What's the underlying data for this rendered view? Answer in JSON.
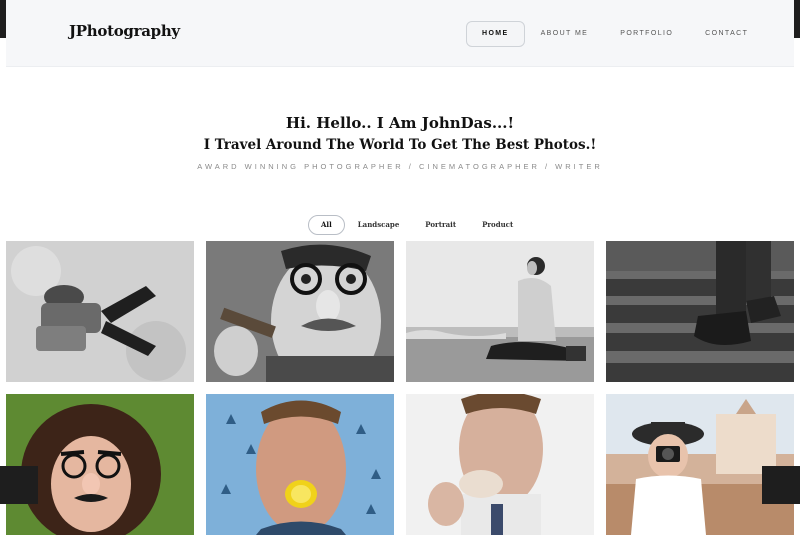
{
  "brand": "JPhotography",
  "nav": [
    {
      "label": "HOME",
      "active": true
    },
    {
      "label": "ABOUT ME",
      "active": false
    },
    {
      "label": "PORTFOLIO",
      "active": false
    },
    {
      "label": "CONTACT",
      "active": false
    }
  ],
  "hero": {
    "greeting": "Hi. Hello.. I Am JohnDas...!",
    "subtitle": "I Travel Around The World To Get The Best Photos.!",
    "tagline": "AWARD WINNING PHOTOGRAPHER / CINEMATOGRAPHER / WRITER"
  },
  "filters": [
    {
      "label": "All",
      "active": true
    },
    {
      "label": "Landscape",
      "active": false
    },
    {
      "label": "Portrait",
      "active": false
    },
    {
      "label": "Product",
      "active": false
    }
  ],
  "gallery": [
    {
      "subject": "person-lying-on-grass",
      "style": "bw"
    },
    {
      "subject": "man-with-glasses-and-cigar",
      "style": "bw"
    },
    {
      "subject": "woman-sitting-on-beach",
      "style": "bw"
    },
    {
      "subject": "boots-on-railway",
      "style": "bw"
    },
    {
      "subject": "woman-with-disguise-glasses",
      "style": "color"
    },
    {
      "subject": "man-biting-lemon",
      "style": "color"
    },
    {
      "subject": "man-eating-pastry",
      "style": "color"
    },
    {
      "subject": "woman-with-camera",
      "style": "color"
    }
  ]
}
